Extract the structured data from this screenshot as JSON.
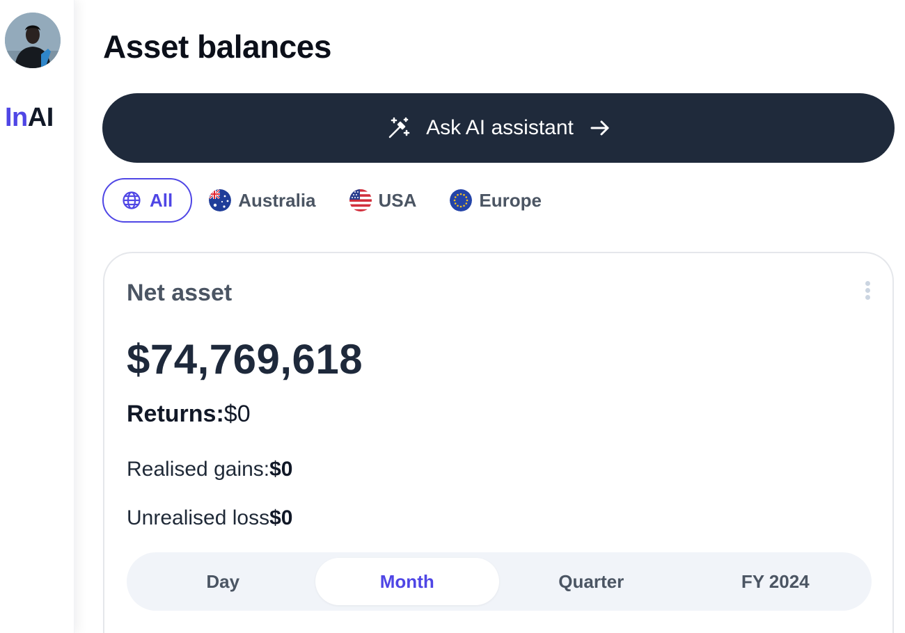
{
  "brand": {
    "logo_prefix": "In",
    "logo_suffix": "AI",
    "accent_color": "#4f46e5"
  },
  "sidebar": {
    "avatar_alt": "user-avatar"
  },
  "page": {
    "title": "Asset balances"
  },
  "assistant": {
    "label": "Ask AI assistant",
    "bg_color": "#1f2a3b"
  },
  "regions": {
    "selected": "All",
    "items": [
      {
        "label": "All",
        "icon": "globe-icon"
      },
      {
        "label": "Australia",
        "icon": "australia-flag-icon"
      },
      {
        "label": "USA",
        "icon": "usa-flag-icon"
      },
      {
        "label": "Europe",
        "icon": "eu-flag-icon"
      }
    ]
  },
  "net_asset": {
    "title": "Net asset",
    "amount": "$74,769,618",
    "returns_label": "Returns:",
    "returns_value": "$0",
    "realised_label": "Realised gains:",
    "realised_value": "$0",
    "unrealised_label": "Unrealised loss",
    "unrealised_value": "$0"
  },
  "periods": {
    "selected": "Month",
    "items": [
      {
        "label": "Day"
      },
      {
        "label": "Month"
      },
      {
        "label": "Quarter"
      },
      {
        "label": "FY 2024"
      }
    ]
  }
}
